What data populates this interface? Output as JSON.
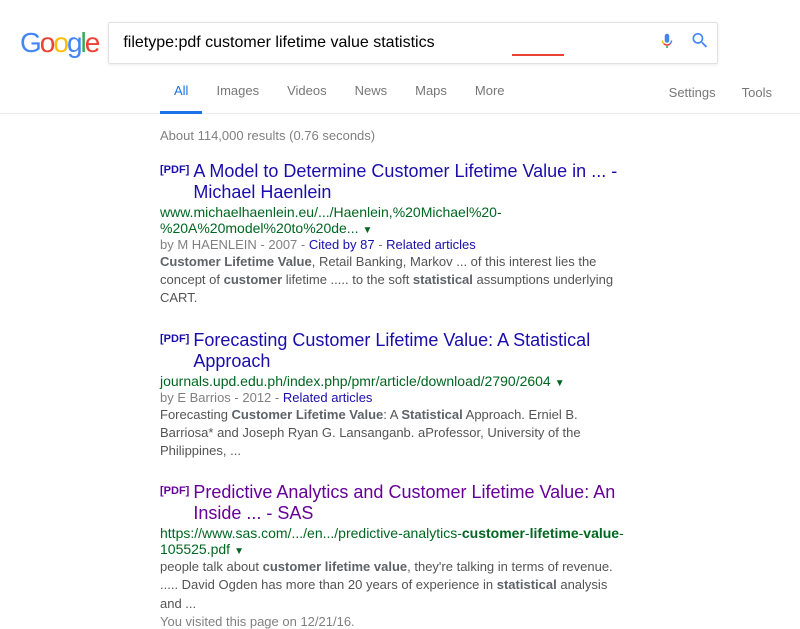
{
  "search": {
    "query": "filetype:pdf customer lifetime value statistics"
  },
  "nav": {
    "tabs": [
      "All",
      "Images",
      "Videos",
      "News",
      "Maps",
      "More"
    ],
    "settings": "Settings",
    "tools": "Tools"
  },
  "stats": "About 114,000 results (0.76 seconds)",
  "results": [
    {
      "badge": "PDF",
      "title": "A Model to Determine Customer Lifetime Value in ... - Michael Haenlein",
      "url": "www.michaelhaenlein.eu/.../Haenlein,%20Michael%20-%20A%20model%20to%20de...",
      "meta_author": "by M HAENLEIN - 2007 - ",
      "cited": "Cited by 87",
      "related": "Related articles",
      "snippet_html": "<span class='bold'>Customer Lifetime Value</span>, Retail Banking, Markov ... of this interest lies the concept of <span class='bold'>customer</span> lifetime ..... to the soft <span class='bold'>statistical</span> assumptions underlying CART."
    },
    {
      "badge": "PDF",
      "title": "Forecasting Customer Lifetime Value: A Statistical Approach",
      "url": "journals.upd.edu.ph/index.php/pmr/article/download/2790/2604",
      "meta_author": "by E Barrios - 2012 - ",
      "related": "Related articles",
      "snippet_html": "Forecasting <span class='bold'>Customer Lifetime Value</span>: A <span class='bold'>Statistical</span> Approach. Erniel B. Barriosa* and Joseph Ryan G. Lansanganb. aProfessor, University of the Philippines, ..."
    },
    {
      "badge": "PDF",
      "title": "Predictive Analytics and Customer Lifetime Value: An Inside ... - SAS",
      "url_html": "https://www.sas.com/.../en.../predictive-analytics-<span class='bold'>customer</span>-<span class='bold'>lifetime</span>-<span class='bold'>value</span>-105525.pdf",
      "snippet_html": "people talk about <span class='bold'>customer lifetime value</span>, they're talking in terms of revenue. ..... David Ogden has more than 20 years of experience in <span class='bold'>statistical</span> analysis and ...",
      "visited": "You visited this page on 12/21/16."
    }
  ]
}
